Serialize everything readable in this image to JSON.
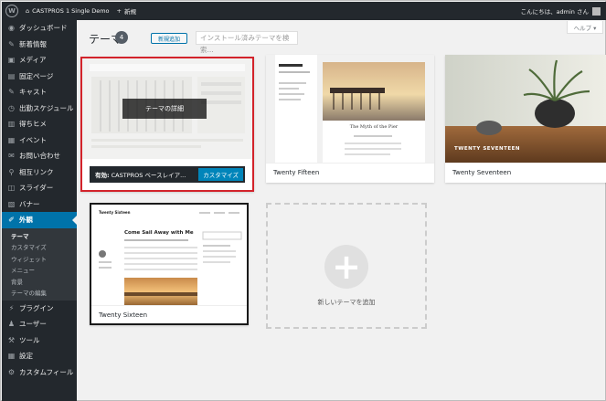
{
  "admin_bar": {
    "site_name": "CASTPROS 1 Single Demo",
    "new_label": "新規",
    "greeting": "こんにちは、admin さん"
  },
  "sidebar": {
    "items": [
      {
        "label": "ダッシュボード",
        "icon": "dashboard-icon",
        "glyph": "◉"
      },
      {
        "label": "新着情報",
        "icon": "pin-icon",
        "glyph": "✎"
      },
      {
        "label": "メディア",
        "icon": "media-icon",
        "glyph": "▣"
      },
      {
        "label": "固定ページ",
        "icon": "page-icon",
        "glyph": "▤"
      },
      {
        "label": "キャスト",
        "icon": "pin-icon",
        "glyph": "✎"
      },
      {
        "label": "出勤スケジュール",
        "icon": "clock-icon",
        "glyph": "◷"
      },
      {
        "label": "得ちヒメ",
        "icon": "chart-icon",
        "glyph": "▥"
      },
      {
        "label": "イベント",
        "icon": "calendar-icon",
        "glyph": "▦"
      },
      {
        "label": "お問い合わせ",
        "icon": "mail-icon",
        "glyph": "✉"
      },
      {
        "label": "相互リンク",
        "icon": "link-icon",
        "glyph": "⚲"
      },
      {
        "label": "スライダー",
        "icon": "slider-icon",
        "glyph": "◫"
      },
      {
        "label": "バナー",
        "icon": "banner-icon",
        "glyph": "▧"
      },
      {
        "label": "外観",
        "icon": "appearance-icon",
        "glyph": "✐",
        "current": true
      }
    ],
    "submenu": [
      {
        "label": "テーマ",
        "current": true
      },
      {
        "label": "カスタマイズ"
      },
      {
        "label": "ウィジェット"
      },
      {
        "label": "メニュー"
      },
      {
        "label": "背景"
      },
      {
        "label": "テーマの編集"
      }
    ],
    "items_after": [
      {
        "label": "プラグイン",
        "icon": "plugin-icon",
        "glyph": "⚡"
      },
      {
        "label": "ユーザー",
        "icon": "user-icon",
        "glyph": "♟"
      },
      {
        "label": "ツール",
        "icon": "tool-icon",
        "glyph": "⚒"
      },
      {
        "label": "設定",
        "icon": "settings-icon",
        "glyph": "▦"
      },
      {
        "label": "カスタムフィール",
        "icon": "custom-field-icon",
        "glyph": "⚙"
      }
    ]
  },
  "header": {
    "title": "テーマ",
    "count": "4",
    "add_new_label": "新規追加",
    "search_placeholder": "インストール済みテーマを検索...",
    "help_label": "ヘルプ ▾"
  },
  "themes": {
    "active": {
      "prefix": "有効:",
      "name": "CASTPROS ベースレイア...",
      "customize_label": "カスタマイズ",
      "detail_label": "テーマの詳細"
    },
    "fifteen": {
      "name": "Twenty Fifteen",
      "preview_title": "The Myth of the Pier"
    },
    "seventeen": {
      "name": "Twenty Seventeen",
      "preview_title": "TWENTY SEVENTEEN"
    },
    "sixteen": {
      "name": "Twenty Sixteen",
      "preview_title": "Come Sail Away with Me",
      "site_title": "Twenty Sixteen"
    },
    "add_new_label": "新しいテーマを追加"
  },
  "colors": {
    "admin_dark": "#23282d",
    "accent_blue": "#0073aa",
    "highlight_red": "#d3232b"
  }
}
